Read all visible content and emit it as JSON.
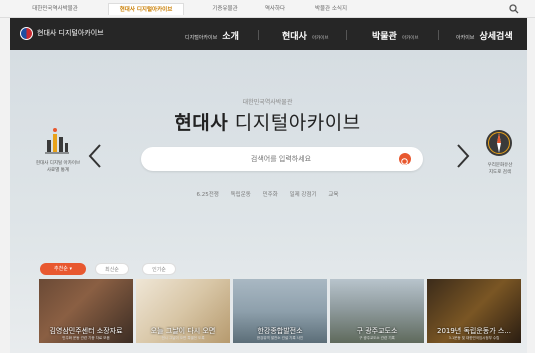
{
  "top_tabs": [
    {
      "label": "대한민국역사박물관",
      "active": false
    },
    {
      "label": "현대사 디지털아카이브",
      "active": true
    },
    {
      "label": "기증유물관",
      "active": false
    },
    {
      "label": "역사하다",
      "active": false
    },
    {
      "label": "박물관 소식지",
      "active": false
    }
  ],
  "nav": {
    "logo_text": "현대사 디지털아카이브",
    "item1_small": "디지털아카이브",
    "item1_big": "소개",
    "item2_big": "현대사",
    "item2_sub": "아카이브",
    "item3_big": "박물관",
    "item3_sub": "아카이브",
    "item4_small": "아카이브",
    "item4_big": "상세검색"
  },
  "hero": {
    "subtitle": "대한민국역사박물관",
    "title_bold": "현대사",
    "title_rest": " 디지털아카이브"
  },
  "search": {
    "placeholder": "검색어를 입력하세요"
  },
  "keywords": [
    "6.25전쟁",
    "독립운동",
    "민주화",
    "일제 강점기",
    "교육"
  ],
  "side_left_label_1": "현대사 디지털 아카이브",
  "side_left_label_2": "사료별 통계",
  "side_right_label_1": "우리문화유산",
  "side_right_label_2": "지도로 검색",
  "filters": {
    "active_label": "추천순",
    "chip2": "최신순",
    "chip3": "인기순"
  },
  "cards": [
    {
      "title": "김영삼민주센터 소장자료",
      "desc": "민주화 운동 관련 기증 자료 모음"
    },
    {
      "title": "오늘 그날이 다시 오면",
      "desc": "전시 그날이 오면 특별전 도록"
    },
    {
      "title": "한강종합발전소",
      "desc": "한강유역 발전소 건설 기록 사진"
    },
    {
      "title": "구 광주교도소",
      "desc": "구 광주교도소 관련 기록"
    },
    {
      "title": "2019년 독립운동가 스...",
      "desc": "3.1운동 및 대한민국임시정부 수립"
    }
  ],
  "colors": {
    "accent": "#e8582f",
    "nav_bg": "#262626",
    "active_tab": "#c97d00"
  }
}
